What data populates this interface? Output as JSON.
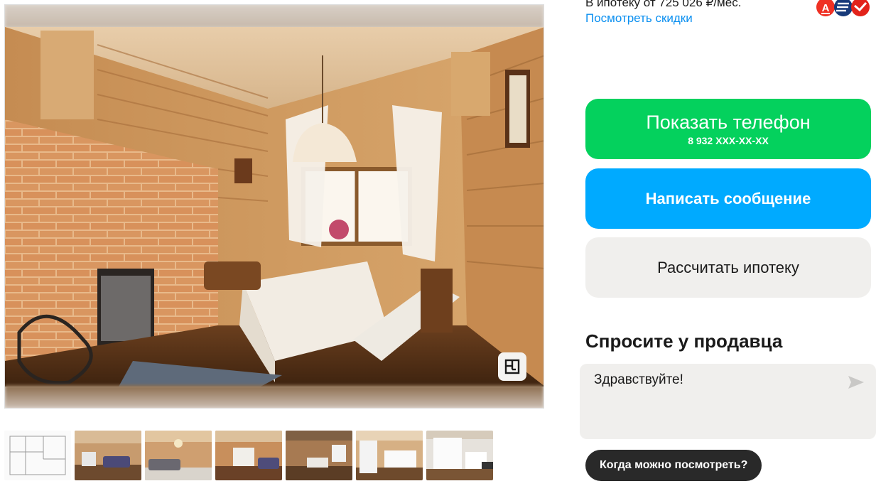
{
  "pricing": {
    "mortgage_text": "В ипотеку от 725 026 ₽/мес.",
    "discount_link": "Посмотреть скидки",
    "bank_logos": [
      "alfa-bank-logo",
      "blue-bank-logo",
      "red-bank-logo"
    ]
  },
  "contact": {
    "show_phone_label": "Показать телефон",
    "phone_masked": "8 932 XXX-XX-XX",
    "write_message_label": "Написать сообщение",
    "calc_mortgage_label": "Рассчитать ипотеку"
  },
  "ask_seller": {
    "title": "Спросите у продавца",
    "message_value": "Здравствуйте!",
    "quick_question": "Когда можно посмотреть?"
  },
  "gallery": {
    "main_photo": "dining-room-wooden-interior",
    "thumbnails": [
      "floor-plan",
      "living-room-sofa",
      "living-room-chandelier",
      "kitchen-dining",
      "living-room-dining",
      "kitchen-white",
      "kitchen-white-2"
    ]
  },
  "colors": {
    "green": "#04d15d",
    "blue": "#00aaff",
    "link": "#0a8ff0",
    "dark_chip": "#292929"
  }
}
